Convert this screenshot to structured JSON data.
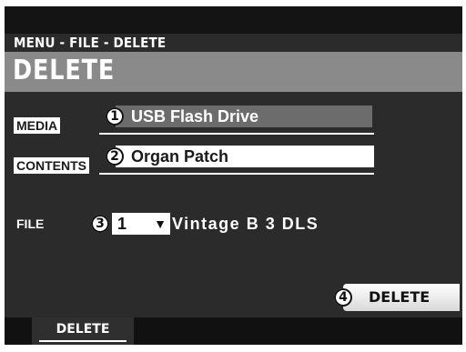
{
  "header": {
    "breadcrumb": "MENU - FILE - DELETE",
    "title": "DELETE"
  },
  "fields": {
    "media": {
      "label": "MEDIA",
      "marker": "1",
      "value": "USB Flash Drive"
    },
    "contents": {
      "label": "CONTENTS",
      "marker": "2",
      "value": "Organ Patch"
    },
    "file": {
      "label": "FILE",
      "marker": "3",
      "number": "1",
      "name": "Vintage  B  3  DLS"
    }
  },
  "actions": {
    "delete_marker": "4",
    "delete_label": "DELETE"
  },
  "bottom": {
    "tab_label": "DELETE"
  },
  "icons": {
    "dropdown": "dropdown-arrow-icon"
  },
  "colors": {
    "screen_bg": "#2b2b2b",
    "title_bar": "#8a8a8a",
    "highlight": "#ffffff"
  }
}
